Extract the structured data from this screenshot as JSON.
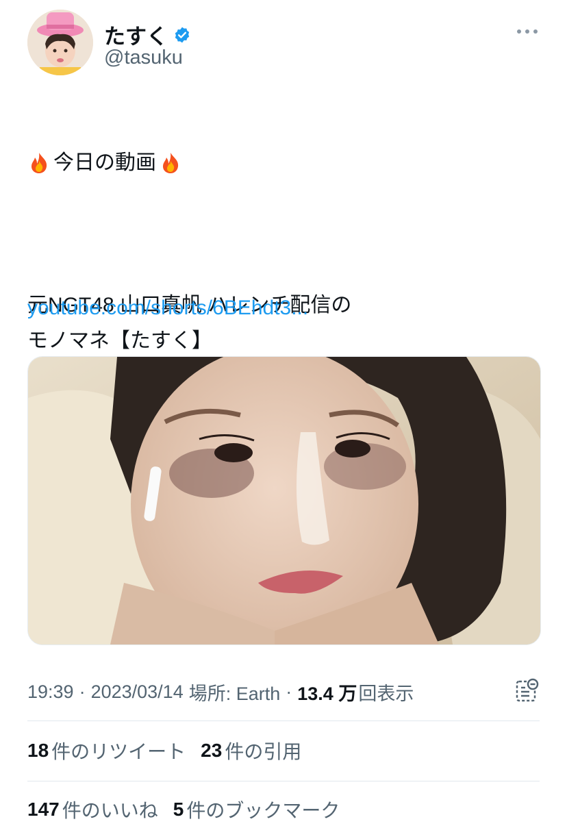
{
  "author": {
    "display_name": "たすく",
    "handle": "@tasuku",
    "verified": true
  },
  "tweet": {
    "line1": "今日の動画",
    "body": "元NGT48 山口真帆 ハレンチ配信の\nモノマネ【たすく】",
    "link": "youtube.com/shorts/6BEhdt3..."
  },
  "meta": {
    "time": "19:39",
    "sep1": "·",
    "date": "2023/03/14",
    "location_label": "場所: Earth",
    "sep2": "·",
    "views_count": "13.4 万",
    "views_label": "回表示"
  },
  "stats": {
    "retweets_count": "18",
    "retweets_label": "件のリツイート",
    "quotes_count": "23",
    "quotes_label": "件の引用",
    "likes_count": "147",
    "likes_label": "件のいいね",
    "bookmarks_count": "5",
    "bookmarks_label": "件のブックマーク"
  },
  "colors": {
    "link": "#1d9bf0",
    "verified": "#1d9bf0",
    "secondary_text": "#536471",
    "primary_text": "#0f1419"
  },
  "icons": [
    "verified-badge-icon",
    "more-icon",
    "fire-icon",
    "view-analytics-icon"
  ]
}
